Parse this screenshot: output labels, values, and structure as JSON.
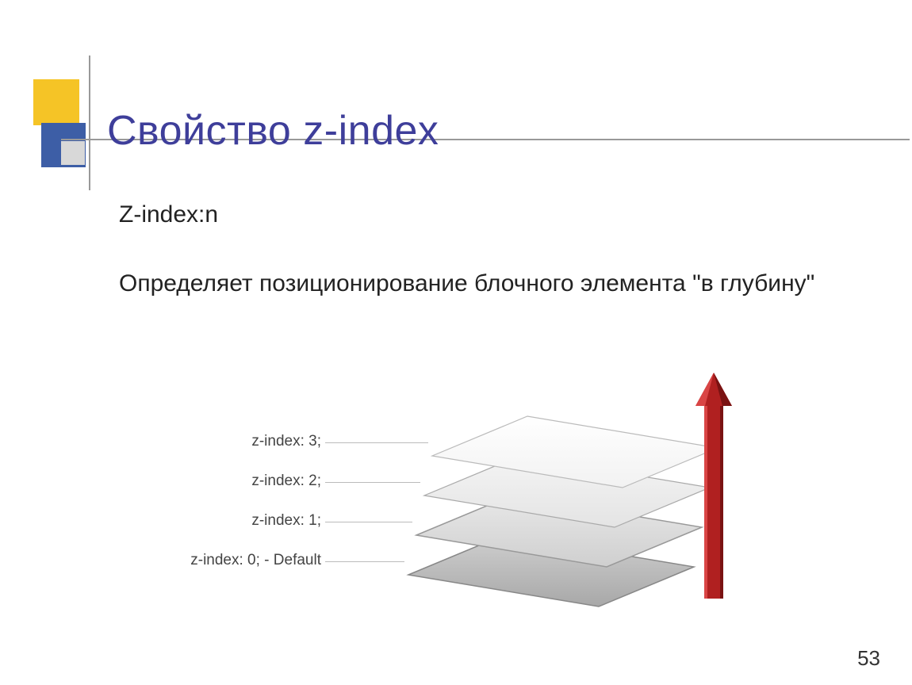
{
  "title": "Свойство z-index",
  "para1": "Z-index:n",
  "para2": "Определяет позиционирование блочного элемента \"в глубину\"",
  "layers": {
    "l3": "z-index: 3;",
    "l2": "z-index: 2;",
    "l1": "z-index: 1;",
    "l0": "z-index: 0; - Default"
  },
  "page": "53"
}
